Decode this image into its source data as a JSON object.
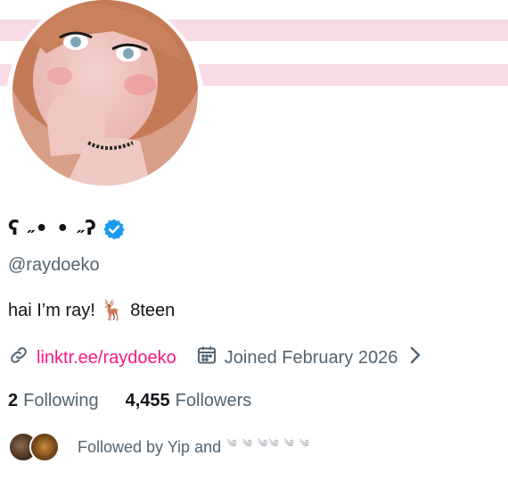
{
  "profile": {
    "display_name": "ʕ ˶• • ˶ʔ",
    "handle": "@raydoeko",
    "bio_text": "hai I’m ray!",
    "bio_emoji": "🦌",
    "bio_age": "8teen",
    "link_text": "linktr.ee/raydoeko",
    "joined_text": "Joined February 2026",
    "following_count": "2",
    "following_label": "Following",
    "followers_count": "4,455",
    "followers_label": "Followers",
    "followed_by_text": "Followed by Yip and",
    "followed_by_others": "༄ ༄ ༄༄ ༄ ༄"
  },
  "icons": {
    "verified": "verified-badge-icon",
    "link": "link-icon",
    "calendar": "calendar-icon",
    "chevron": "chevron-right-icon"
  },
  "colors": {
    "link": "#f91880",
    "verified": "#1d9bf0",
    "secondary_text": "#536471",
    "banner_stripe": "#f7dbe6"
  }
}
